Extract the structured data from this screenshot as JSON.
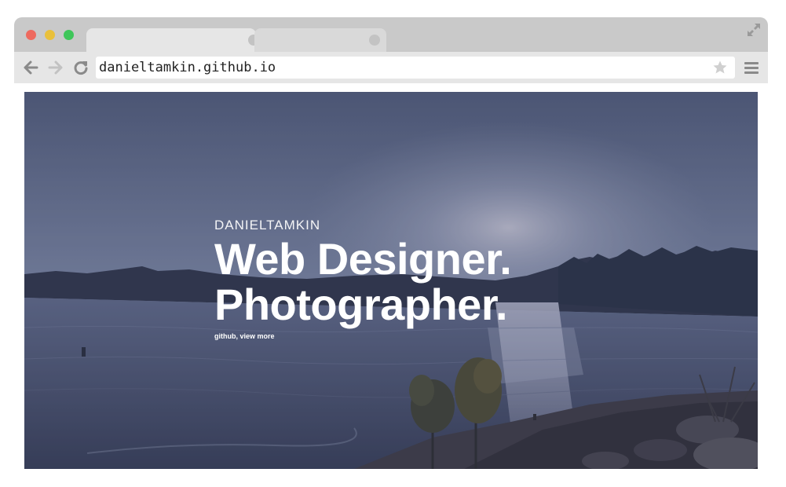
{
  "browser": {
    "url": "danieltamkin.github.io",
    "icons": {
      "close": "close-dot",
      "minimize": "minimize-dot",
      "maximize": "maximize-dot",
      "back": "arrow-left-icon",
      "forward": "arrow-right-icon",
      "reload": "reload-icon",
      "bookmark": "star-icon",
      "menu": "hamburger-menu-icon",
      "fullscreen": "expand-icon"
    }
  },
  "hero": {
    "brand": "DANIELTAMKIN",
    "headline_line1": "Web Designer.",
    "headline_line2": "Photographer.",
    "link_github": "github",
    "separator": ", ",
    "link_view_more": "view more"
  },
  "colors": {
    "titlebar": "#c9c9c9",
    "toolbar": "#e6e6e6",
    "close": "#ee6a5f",
    "minimize": "#e9c03b",
    "maximize": "#3fc65a"
  }
}
